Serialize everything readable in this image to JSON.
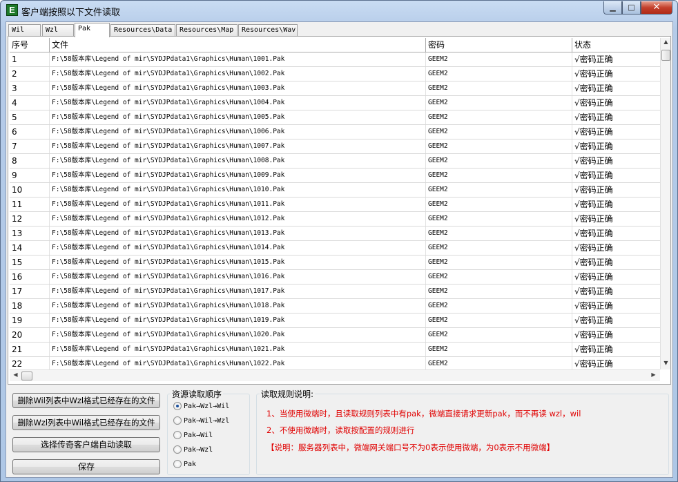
{
  "window": {
    "title": "客户端按照以下文件读取",
    "app_icon_letter": "E",
    "min_glyph": "▁",
    "max_glyph": "□",
    "close_glyph": "✕"
  },
  "tabs": [
    {
      "label": "Wil"
    },
    {
      "label": "Wzl"
    },
    {
      "label": "Pak",
      "active": true
    },
    {
      "label": "Resources\\Data"
    },
    {
      "label": "Resources\\Map"
    },
    {
      "label": "Resources\\Wav"
    }
  ],
  "table": {
    "columns": [
      "序号",
      "文件",
      "密码",
      "状态"
    ],
    "rows": [
      {
        "index": "1",
        "file": "F:\\58版本库\\Legend of mir\\SYDJPdata1\\Graphics\\Human\\1001.Pak",
        "password": "GEEM2",
        "status": "√密码正确"
      },
      {
        "index": "2",
        "file": "F:\\58版本库\\Legend of mir\\SYDJPdata1\\Graphics\\Human\\1002.Pak",
        "password": "GEEM2",
        "status": "√密码正确"
      },
      {
        "index": "3",
        "file": "F:\\58版本库\\Legend of mir\\SYDJPdata1\\Graphics\\Human\\1003.Pak",
        "password": "GEEM2",
        "status": "√密码正确"
      },
      {
        "index": "4",
        "file": "F:\\58版本库\\Legend of mir\\SYDJPdata1\\Graphics\\Human\\1004.Pak",
        "password": "GEEM2",
        "status": "√密码正确"
      },
      {
        "index": "5",
        "file": "F:\\58版本库\\Legend of mir\\SYDJPdata1\\Graphics\\Human\\1005.Pak",
        "password": "GEEM2",
        "status": "√密码正确"
      },
      {
        "index": "6",
        "file": "F:\\58版本库\\Legend of mir\\SYDJPdata1\\Graphics\\Human\\1006.Pak",
        "password": "GEEM2",
        "status": "√密码正确"
      },
      {
        "index": "7",
        "file": "F:\\58版本库\\Legend of mir\\SYDJPdata1\\Graphics\\Human\\1007.Pak",
        "password": "GEEM2",
        "status": "√密码正确"
      },
      {
        "index": "8",
        "file": "F:\\58版本库\\Legend of mir\\SYDJPdata1\\Graphics\\Human\\1008.Pak",
        "password": "GEEM2",
        "status": "√密码正确"
      },
      {
        "index": "9",
        "file": "F:\\58版本库\\Legend of mir\\SYDJPdata1\\Graphics\\Human\\1009.Pak",
        "password": "GEEM2",
        "status": "√密码正确"
      },
      {
        "index": "10",
        "file": "F:\\58版本库\\Legend of mir\\SYDJPdata1\\Graphics\\Human\\1010.Pak",
        "password": "GEEM2",
        "status": "√密码正确"
      },
      {
        "index": "11",
        "file": "F:\\58版本库\\Legend of mir\\SYDJPdata1\\Graphics\\Human\\1011.Pak",
        "password": "GEEM2",
        "status": "√密码正确"
      },
      {
        "index": "12",
        "file": "F:\\58版本库\\Legend of mir\\SYDJPdata1\\Graphics\\Human\\1012.Pak",
        "password": "GEEM2",
        "status": "√密码正确"
      },
      {
        "index": "13",
        "file": "F:\\58版本库\\Legend of mir\\SYDJPdata1\\Graphics\\Human\\1013.Pak",
        "password": "GEEM2",
        "status": "√密码正确"
      },
      {
        "index": "14",
        "file": "F:\\58版本库\\Legend of mir\\SYDJPdata1\\Graphics\\Human\\1014.Pak",
        "password": "GEEM2",
        "status": "√密码正确"
      },
      {
        "index": "15",
        "file": "F:\\58版本库\\Legend of mir\\SYDJPdata1\\Graphics\\Human\\1015.Pak",
        "password": "GEEM2",
        "status": "√密码正确"
      },
      {
        "index": "16",
        "file": "F:\\58版本库\\Legend of mir\\SYDJPdata1\\Graphics\\Human\\1016.Pak",
        "password": "GEEM2",
        "status": "√密码正确"
      },
      {
        "index": "17",
        "file": "F:\\58版本库\\Legend of mir\\SYDJPdata1\\Graphics\\Human\\1017.Pak",
        "password": "GEEM2",
        "status": "√密码正确"
      },
      {
        "index": "18",
        "file": "F:\\58版本库\\Legend of mir\\SYDJPdata1\\Graphics\\Human\\1018.Pak",
        "password": "GEEM2",
        "status": "√密码正确"
      },
      {
        "index": "19",
        "file": "F:\\58版本库\\Legend of mir\\SYDJPdata1\\Graphics\\Human\\1019.Pak",
        "password": "GEEM2",
        "status": "√密码正确"
      },
      {
        "index": "20",
        "file": "F:\\58版本库\\Legend of mir\\SYDJPdata1\\Graphics\\Human\\1020.Pak",
        "password": "GEEM2",
        "status": "√密码正确"
      },
      {
        "index": "21",
        "file": "F:\\58版本库\\Legend of mir\\SYDJPdata1\\Graphics\\Human\\1021.Pak",
        "password": "GEEM2",
        "status": "√密码正确"
      },
      {
        "index": "22",
        "file": "F:\\58版本库\\Legend of mir\\SYDJPdata1\\Graphics\\Human\\1022.Pak",
        "password": "GEEM2",
        "status": "√密码正确"
      }
    ]
  },
  "buttons": {
    "delete_wil": "删除Wil列表中Wzl格式已经存在的文件",
    "delete_wzl": "删除Wzl列表中Wil格式已经存在的文件",
    "auto_read": "选择传奇客户端自动读取",
    "save": "保存"
  },
  "order_group": {
    "title": "资源读取顺序",
    "options": [
      {
        "label": "Pak→Wzl→Wil",
        "selected": true
      },
      {
        "label": "Pak→Wil→Wzl",
        "selected": false
      },
      {
        "label": "Pak→Wil",
        "selected": false
      },
      {
        "label": "Pak→Wzl",
        "selected": false
      },
      {
        "label": "Pak",
        "selected": false
      }
    ]
  },
  "rules_group": {
    "title": "读取规则说明:",
    "line1": "1、当使用微端时，且读取规则列表中有pak，微端直接请求更新pak，而不再读 wzl，wil",
    "line2": "2、不使用微端时，读取按配置的规则进行",
    "line3": "【说明：服务器列表中，微端网关端口号不为0表示使用微端，为0表示不用微端】",
    "text_color": "#e00000"
  },
  "scroll": {
    "up": "▲",
    "down": "▼",
    "left": "◀",
    "right": "▶"
  }
}
